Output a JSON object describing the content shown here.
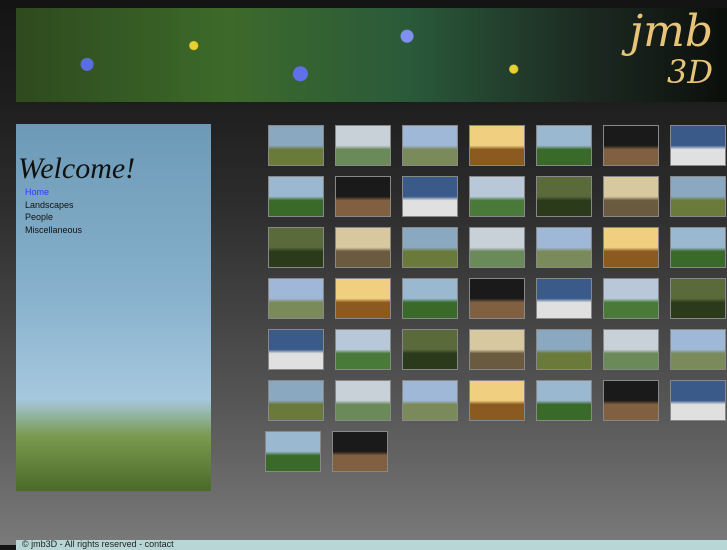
{
  "header": {
    "logo_top": "jmb",
    "logo_bottom": "3D"
  },
  "welcome": "Welcome!",
  "nav": [
    {
      "label": "Home",
      "active": true
    },
    {
      "label": "Landscapes"
    },
    {
      "label": "People"
    },
    {
      "label": "Miscellaneous"
    }
  ],
  "gallery": {
    "count": 44,
    "palette": [
      [
        "#8aa8c0",
        "#6a7a3a"
      ],
      [
        "#b8c8d8",
        "#4a7a3a"
      ],
      [
        "#9ab8d0",
        "#3a6a2a"
      ],
      [
        "#c8d0d8",
        "#6a8a5a"
      ],
      [
        "#5a6a3a",
        "#2a3a1a"
      ],
      [
        "#1a1a1a",
        "#806040"
      ],
      [
        "#a0b8d8",
        "#7a8a5a"
      ],
      [
        "#d8c8a0",
        "#6a5a40"
      ],
      [
        "#3a5a8a",
        "#e0e0e0"
      ],
      [
        "#f0d080",
        "#8a5a20"
      ]
    ]
  },
  "footer": "© jmb3D - All rights reserved - contact"
}
